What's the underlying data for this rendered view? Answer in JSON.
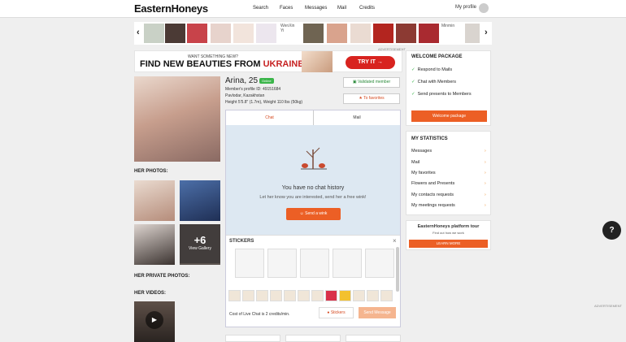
{
  "topbar": {
    "logo": "EasternHoneys",
    "nav": [
      "Search",
      "Faces",
      "Messages",
      "Mail",
      "Credits"
    ],
    "my_profile": "My profile"
  },
  "strip": {
    "broken_labels": [
      "WenXin\nYi",
      "Minmin"
    ],
    "prev_icon": "chevron-left-icon",
    "next_icon": "chevron-right-icon"
  },
  "ad": {
    "small": "WANT SOMETHING NEW?",
    "big_prefix": "FIND NEW BEAUTIES FROM ",
    "big_highlight": "UKRAINE",
    "button": "TRY IT →",
    "label": "ADVERTISEMENT"
  },
  "profile": {
    "name": "Arina, 25",
    "online": "Online",
    "id": "Member's profile ID: 49151684",
    "location": "Pavlodar, Kazakhstan",
    "stats": "Height 5'5.8\" (1.7m), Weight 110 lbs (50kg)",
    "validated": "Validated member",
    "favorites": "To favorites"
  },
  "chat": {
    "tabs": [
      "Chat",
      "Mail"
    ],
    "no_chat": "You have no chat history",
    "no_chat_sub": "Let her know you are interested, send her a free wink!",
    "wink_button": "Send a wink",
    "stickers_title": "STICKERS",
    "close_icon": "close-icon",
    "cost": "Cost of Live Chat is 2 credits/min.",
    "stickers_button": "Stickers",
    "send_button": "Send Message"
  },
  "sections": {
    "photos": "HER PHOTOS:",
    "private": "HER PRIVATE PHOTOS:",
    "videos": "HER VIDEOS:",
    "more_count": "+6",
    "more_label": "View Gallery"
  },
  "welcome": {
    "title": "WELCOME PACKAGE",
    "items": [
      "Respond to Mails",
      "Chat with Members",
      "Send presents to Members"
    ],
    "button": "Welcome package"
  },
  "statistics": {
    "title": "MY STATISTICS",
    "items": [
      "Messages",
      "Mail",
      "My favorites",
      "Flowers and Presents",
      "My contacts requests",
      "My meetings requests"
    ]
  },
  "tour": {
    "title": "EasternHoneys platform tour",
    "sub": "Find out how we work",
    "button": "LEARN MORE"
  },
  "side_ad_label": "ADVERTISEMENT",
  "help": "?",
  "colors": {
    "accent": "#ec5f25",
    "online": "#3bb54a",
    "ad_red": "#d8231f"
  }
}
